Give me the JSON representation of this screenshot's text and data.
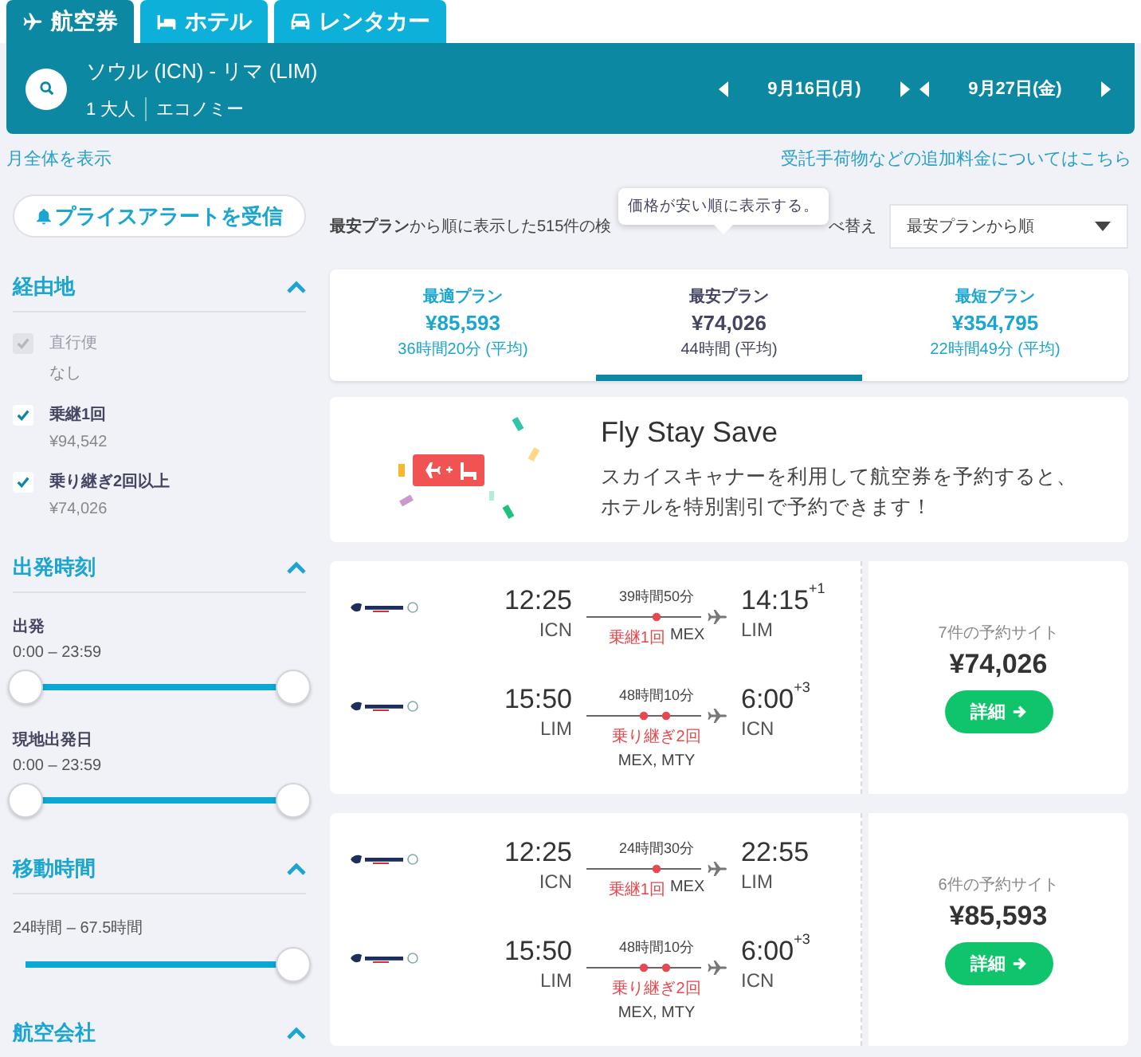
{
  "tabs": [
    {
      "label": "航空券",
      "selected": true
    },
    {
      "label": "ホテル",
      "selected": false
    },
    {
      "label": "レンタカー",
      "selected": false
    }
  ],
  "search": {
    "route": "ソウル (ICN) - リマ (LIM)",
    "passengers": "1 大人",
    "cabin": "エコノミー",
    "dates": [
      "9月16日(月)",
      "9月27日(金)"
    ]
  },
  "links": {
    "month": "月全体を表示",
    "fees": "受託手荷物などの追加料金についてはこちら"
  },
  "sidebar": {
    "alert_button": "プライスアラートを受信",
    "sections": [
      {
        "title": "経由地",
        "expanded": true,
        "kind": "checks",
        "items": [
          {
            "label": "直行便",
            "sub": "なし",
            "checked": true,
            "disabled": true
          },
          {
            "label": "乗継1回",
            "sub": "¥94,542",
            "checked": true,
            "disabled": false
          },
          {
            "label": "乗り継ぎ2回以上",
            "sub": "¥74,026",
            "checked": true,
            "disabled": false
          }
        ]
      },
      {
        "title": "出発時刻",
        "expanded": true,
        "kind": "sliders",
        "items": [
          {
            "label": "出発",
            "range": "0:00 – 23:59",
            "thumbs": [
              {
                "level": 0
              },
              {
                "level": 1
              }
            ]
          },
          {
            "label": "現地出発日",
            "range": "0:00 – 23:59",
            "thumbs": [
              {
                "level": 0
              },
              {
                "level": 1
              }
            ]
          }
        ]
      },
      {
        "title": "移動時間",
        "expanded": true,
        "kind": "sliders",
        "items": [
          {
            "range": "24時間 – 67.5時間",
            "thumbs": [
              {
                "level": 1
              }
            ]
          }
        ]
      },
      {
        "title": "航空会社",
        "expanded": true,
        "kind": "none"
      }
    ]
  },
  "results": {
    "summary": "**最安プラン**から順に表示した515件の検",
    "sort_label": "べ替え",
    "tooltip": "価格が安い順に表示する。",
    "sort": "最安プランから順"
  },
  "plans": [
    {
      "label": "最適プラン",
      "price": "¥85,593",
      "duration": "36時間20分 (平均)",
      "selected": false
    },
    {
      "label": "最安プラン",
      "price": "¥74,026",
      "duration": "44時間 (平均)",
      "selected": true
    },
    {
      "label": "最短プラン",
      "price": "¥354,795",
      "duration": "22時間49分 (平均)",
      "selected": false
    }
  ],
  "promo": {
    "title": "Fly Stay Save",
    "text": "スカイスキャナーを利用して航空券を予約すると、ホテルを特別割引で予約できます！"
  },
  "flights": [
    {
      "sites": "7件の予約サイト",
      "price": "¥74,026",
      "button": "詳細",
      "legs": [
        {
          "kind": "one_stop",
          "dep_time": "12:25",
          "dep_airport": "ICN",
          "duration": "39時間50分",
          "stops": "乗継1回",
          "via": "MEX",
          "arr_time": "14:15",
          "days": "+1",
          "arr_airport": "LIM"
        },
        {
          "kind": "two_stop",
          "dep_time": "15:50",
          "dep_airport": "LIM",
          "duration": "48時間10分",
          "stops": "乗り継ぎ2回",
          "via": "MEX, MTY",
          "arr_time": "6:00",
          "days": "+3",
          "arr_airport": "ICN"
        }
      ]
    },
    {
      "sites": "6件の予約サイト",
      "price": "¥85,593",
      "button": "詳細",
      "legs": [
        {
          "kind": "one_stop",
          "dep_time": "12:25",
          "dep_airport": "ICN",
          "duration": "24時間30分",
          "stops": "乗継1回",
          "via": "MEX",
          "arr_time": "22:55",
          "arr_airport": "LIM"
        },
        {
          "kind": "two_stop",
          "dep_time": "15:50",
          "dep_airport": "LIM",
          "duration": "48時間10分",
          "stops": "乗り継ぎ2回",
          "via": "MEX, MTY",
          "arr_time": "6:00",
          "days": "+3",
          "arr_airport": "ICN"
        }
      ]
    }
  ]
}
